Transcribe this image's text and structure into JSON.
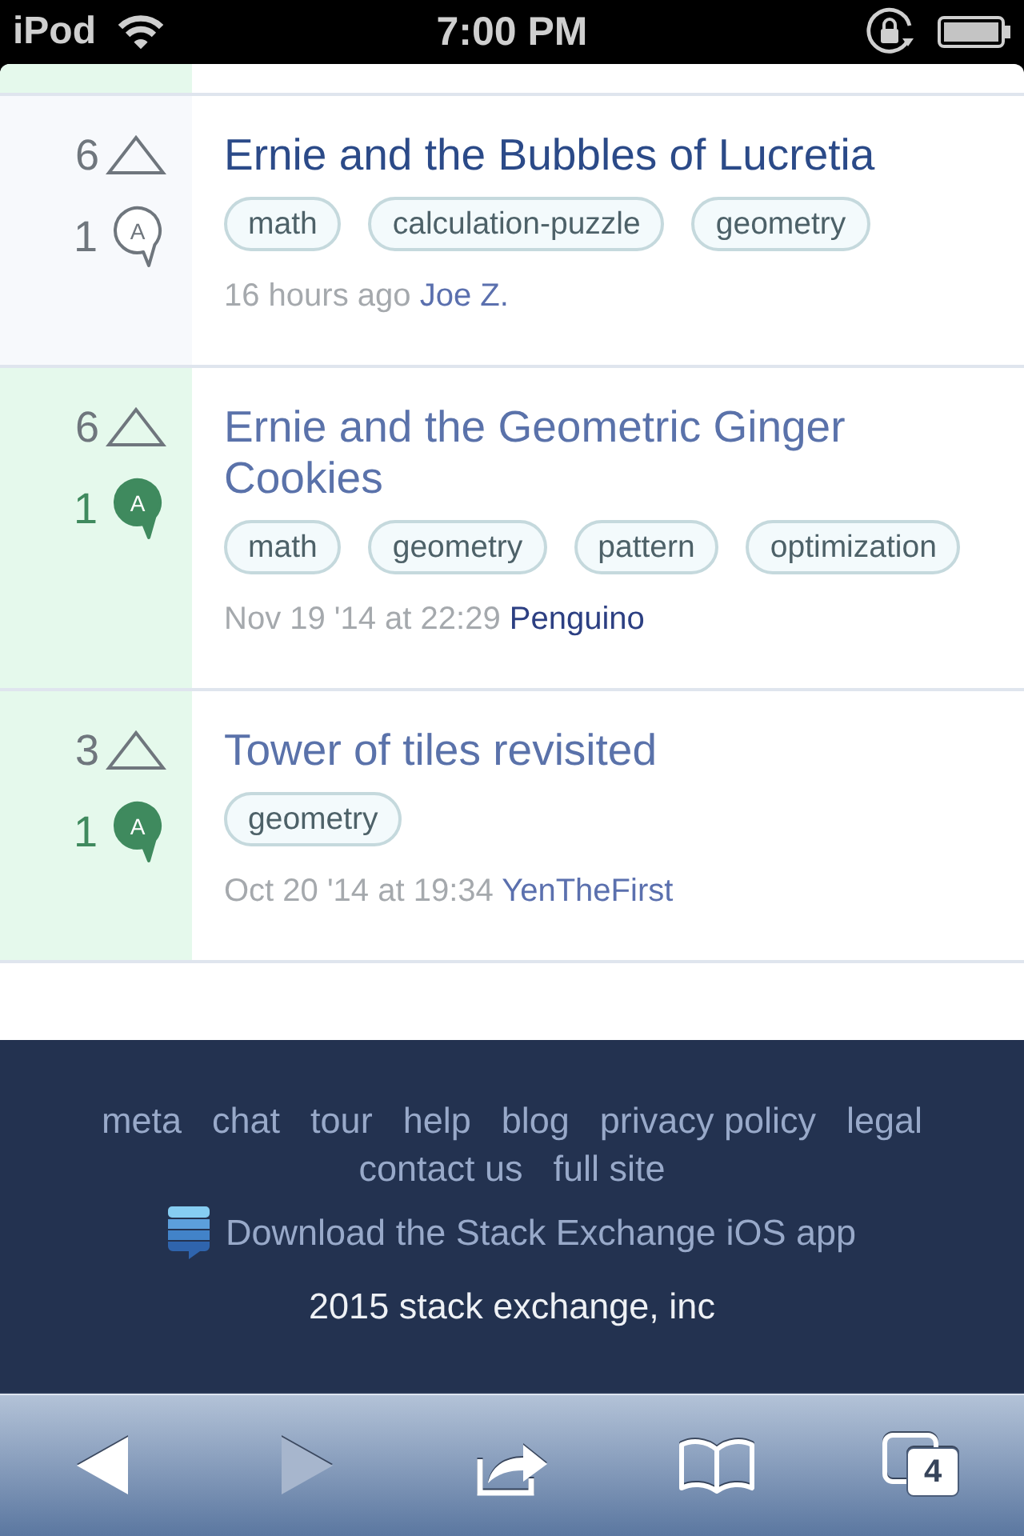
{
  "status_bar": {
    "carrier": "iPod",
    "time": "7:00 PM"
  },
  "previous_row": {
    "accepted": true
  },
  "questions": [
    {
      "votes": "6",
      "answers": "1",
      "badge": "A",
      "accepted": false,
      "title": "Ernie and the Bubbles of Lucretia",
      "visited": true,
      "tags": [
        "math",
        "calculation-puzzle",
        "geometry"
      ],
      "time": "16 hours ago",
      "author": "Joe Z.",
      "author_visited": false
    },
    {
      "votes": "6",
      "answers": "1",
      "badge": "A",
      "accepted": true,
      "title": "Ernie and the Geometric Ginger Cookies",
      "visited": false,
      "tags": [
        "math",
        "geometry",
        "pattern",
        "optimization"
      ],
      "time": "Nov 19 '14 at 22:29",
      "author": "Penguino",
      "author_visited": true
    },
    {
      "votes": "3",
      "answers": "1",
      "badge": "A",
      "accepted": true,
      "title": "Tower of tiles revisited",
      "visited": false,
      "tags": [
        "geometry"
      ],
      "time": "Oct 20 '14 at 19:34",
      "author": "YenTheFirst",
      "author_visited": false
    }
  ],
  "footer": {
    "links": [
      "meta",
      "chat",
      "tour",
      "help",
      "blog",
      "privacy policy",
      "legal",
      "contact us",
      "full site"
    ],
    "app_link": "Download the Stack Exchange iOS app",
    "copyright": "2015 stack exchange, inc"
  },
  "toolbar": [
    {
      "kind": "back",
      "disabled": false
    },
    {
      "kind": "forward",
      "disabled": true
    },
    {
      "kind": "share",
      "disabled": false
    },
    {
      "kind": "bookmarks",
      "disabled": false
    },
    {
      "kind": "tabs",
      "disabled": false,
      "count": "4"
    }
  ]
}
